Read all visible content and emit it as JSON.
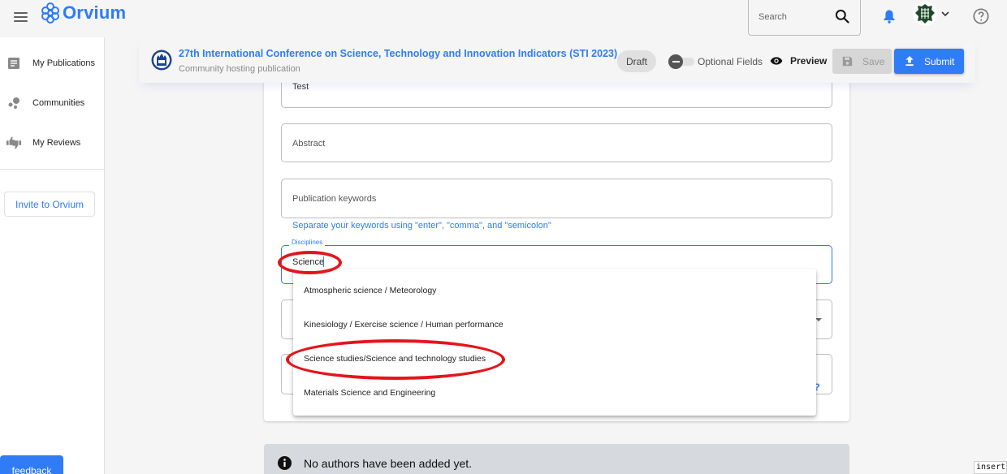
{
  "app": {
    "brand": "Orvium",
    "brand_color": "#2f7cf6"
  },
  "topbar": {
    "search_placeholder": "Search",
    "icons": [
      "menu-icon",
      "search-icon",
      "bell-icon",
      "avatar",
      "chevron-down-icon",
      "help-icon"
    ]
  },
  "sidebar": {
    "items": [
      {
        "label": "My Publications",
        "icon": "document-icon"
      },
      {
        "label": "Communities",
        "icon": "communities-icon"
      },
      {
        "label": "My Reviews",
        "icon": "reviews-icon"
      }
    ],
    "invite_label": "Invite to Orvium"
  },
  "publication_header": {
    "title": "27th International Conference on Science, Technology and Innovation Indicators (STI 2023)",
    "subtitle": "Community hosting publication",
    "status_badge": "Draft",
    "optional_fields_label": "Optional Fields",
    "optional_fields_on": false,
    "preview_label": "Preview",
    "save_label": "Save",
    "submit_label": "Submit"
  },
  "form": {
    "title_value": "Test",
    "abstract_placeholder": "Abstract",
    "keywords_placeholder": "Publication keywords",
    "keywords_hint": "Separate your keywords using \"enter\", \"comma\", and \"semicolon\"",
    "disciplines_label": "Disciplines",
    "disciplines_value": "Science",
    "help_link_partial": "his?",
    "discipline_options": [
      "Atmospheric science / Meteorology",
      "Kinesiology / Exercise science / Human performance",
      "Science studies/Science and technology studies",
      "Materials Science and Engineering"
    ],
    "highlighted_option_index": 2
  },
  "authors": {
    "empty_message": "No authors have been added yet."
  },
  "floating": {
    "feedback_label": "feedback",
    "insert_label": "insert"
  }
}
